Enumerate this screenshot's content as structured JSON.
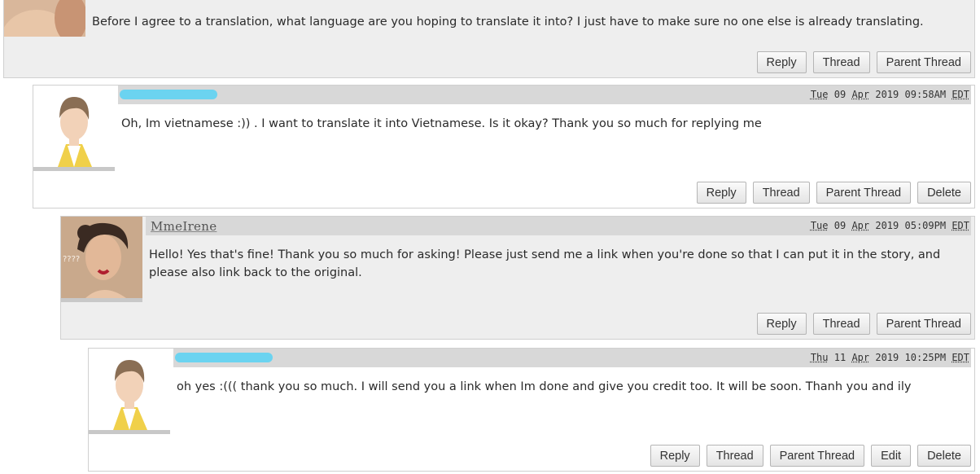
{
  "comments": [
    {
      "username": "",
      "timestamp": "",
      "body": "Before I agree to a translation, what language are you hoping to translate it into? I just have to make sure no one else is already translating.",
      "actions": [
        "Reply",
        "Thread",
        "Parent Thread"
      ]
    },
    {
      "username": "",
      "timestamp": {
        "day": "Tue",
        "date": "09",
        "month": "Apr",
        "year": "2019",
        "time": "09:58AM",
        "tz": "EDT"
      },
      "body": "Oh, Im vietnamese :)) . I want to translate it into Vietnamese. Is it okay? Thank you so much for replying me",
      "actions": [
        "Reply",
        "Thread",
        "Parent Thread",
        "Delete"
      ]
    },
    {
      "username": "MmeIrene",
      "timestamp": {
        "day": "Tue",
        "date": "09",
        "month": "Apr",
        "year": "2019",
        "time": "05:09PM",
        "tz": "EDT"
      },
      "body": "Hello! Yes that's fine! Thank you so much for asking! Please just send me a link when you're done so that I can put it in the story, and please also link back to the original.",
      "actions": [
        "Reply",
        "Thread",
        "Parent Thread"
      ]
    },
    {
      "username": "",
      "timestamp": {
        "day": "Thu",
        "date": "11",
        "month": "Apr",
        "year": "2019",
        "time": "10:25PM",
        "tz": "EDT"
      },
      "body": "oh yes :((( thank you so much. I will send you a link when Im done and give you credit too. It will be soon. Thanh you and ily",
      "actions": [
        "Reply",
        "Thread",
        "Parent Thread",
        "Edit",
        "Delete"
      ]
    }
  ],
  "avatar_text": "????",
  "colors": {
    "redaction": "#5fd3f3",
    "header_bg": "#d8d8d8",
    "panel_bg": "#eeeeee"
  }
}
